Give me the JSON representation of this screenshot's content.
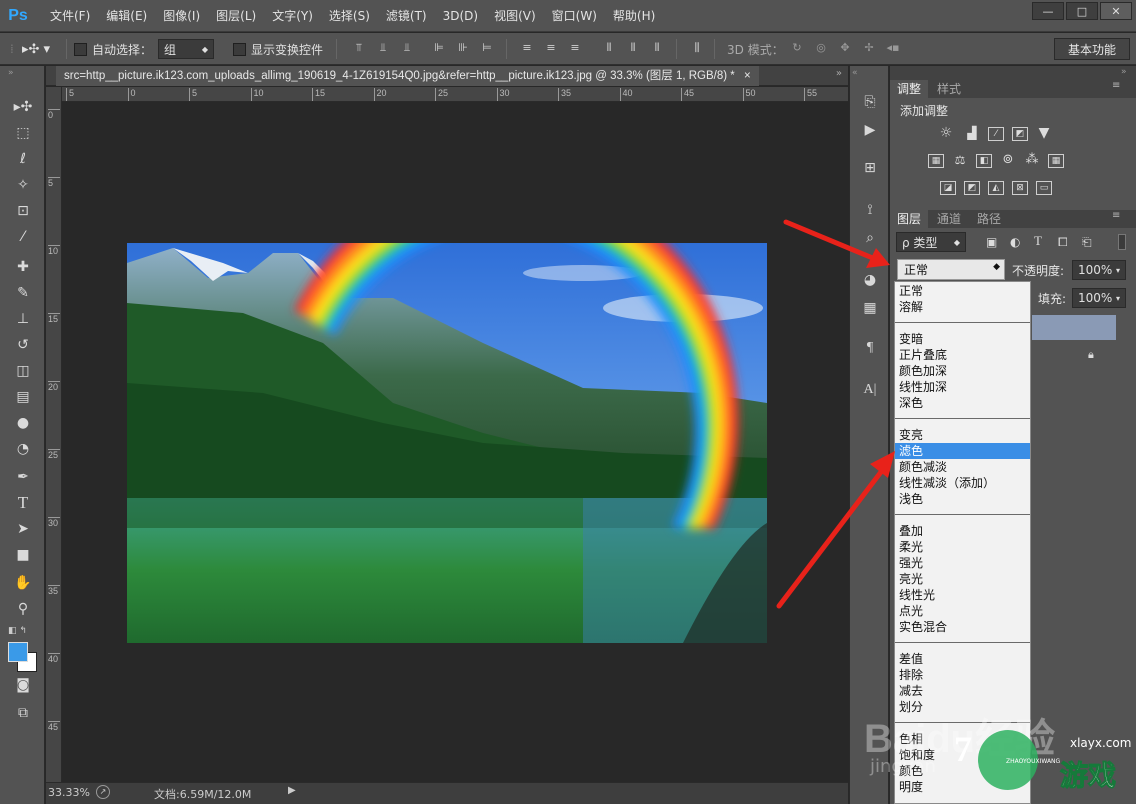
{
  "app": {
    "logo": "Ps"
  },
  "menubar": {
    "items": [
      "文件(F)",
      "编辑(E)",
      "图像(I)",
      "图层(L)",
      "文字(Y)",
      "选择(S)",
      "滤镜(T)",
      "3D(D)",
      "视图(V)",
      "窗口(W)",
      "帮助(H)"
    ]
  },
  "window_controls": {
    "minimize": "—",
    "maximize": "□",
    "close": "✕"
  },
  "options": {
    "auto_select_label": "自动选择：",
    "auto_select_value": "组",
    "show_transform_label": "显示变换控件",
    "mode_3d_label": "3D 模式：",
    "workspace": "基本功能"
  },
  "document": {
    "tab_title": "src=http__picture.ik123.com_uploads_allimg_190619_4-1Z619154Q0.jpg&refer=http__picture.ik123.jpg @ 33.3% (图层 1, RGB/8) *",
    "tab_close": "×",
    "ruler_top_labels": [
      "5",
      "0",
      "5",
      "10",
      "15",
      "20",
      "25",
      "30",
      "35",
      "40",
      "45",
      "50",
      "55"
    ],
    "ruler_left_labels": [
      "0",
      "5",
      "10",
      "15",
      "20",
      "25",
      "30",
      "35",
      "40",
      "45"
    ],
    "zoom": "33.33%",
    "doc_info": "文档:6.59M/12.0M"
  },
  "panels": {
    "adjust_tab": "调整",
    "style_tab": "样式",
    "add_adjustment": "添加调整",
    "layers_tab": "图层",
    "channels_tab": "通道",
    "paths_tab": "路径",
    "filter_kind": "ρ 类型",
    "blend_mode": "正常",
    "opacity_label": "不透明度:",
    "opacity_value": "100%",
    "fill_label": "填充:",
    "fill_value": "100%"
  },
  "blend_menu": {
    "groups": [
      [
        "正常",
        "溶解"
      ],
      [
        "变暗",
        "正片叠底",
        "颜色加深",
        "线性加深",
        "深色"
      ],
      [
        "变亮",
        "滤色",
        "颜色减淡",
        "线性减淡（添加）",
        "浅色"
      ],
      [
        "叠加",
        "柔光",
        "强光",
        "亮光",
        "线性光",
        "点光",
        "实色混合"
      ],
      [
        "差值",
        "排除",
        "减去",
        "划分"
      ],
      [
        "色相",
        "饱和度",
        "颜色",
        "明度"
      ]
    ],
    "highlighted": "滤色"
  },
  "watermark": {
    "left": "Baidu经验",
    "left_sub": "jingyan",
    "right_url": "xlayx.com",
    "right_text": "游戏",
    "right_sub": "ZHAOYOUXIWANG"
  },
  "colors": {
    "accent": "#3a8ee6",
    "arrow": "#e8221a",
    "ui_bg": "#535353",
    "canvas_bg": "#282828"
  }
}
